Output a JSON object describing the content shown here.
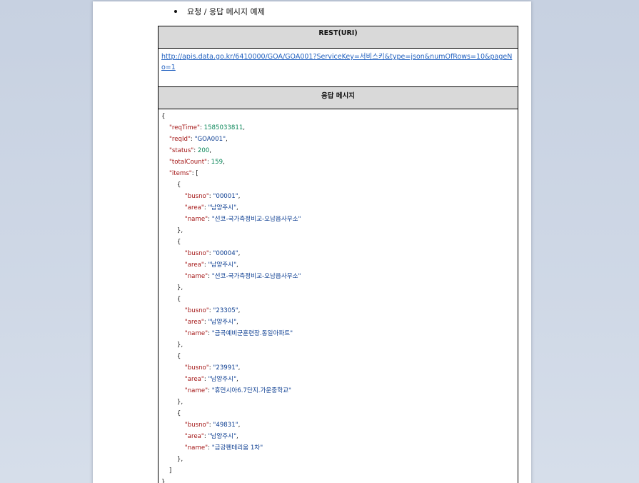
{
  "document": {
    "bullet_text": "요청 / 응답 메시지 예제",
    "table": {
      "request_header": "REST(URI)",
      "request_url": "http://apis.data.go.kr/6410000/GOA/GOA001?ServiceKey=서비스키&type=json&numOfRows=10&pageNo=1",
      "response_header": "응답 메시지"
    },
    "response": {
      "reqTime": "1585033811",
      "reqId": "\"GOA001\"",
      "status": "200",
      "totalCount": "159",
      "items": [
        {
          "busno": "\"00001\"",
          "area": "\"남양주시\"",
          "name": "\"선코-국가측정비교-오남읍사무소\""
        },
        {
          "busno": "\"00004\"",
          "area": "\"남양주시\"",
          "name": "\"선코-국가측정비교-오남읍사무소\""
        },
        {
          "busno": "\"23305\"",
          "area": "\"남양주시\"",
          "name": "\"금곡예비군훈련장.동일아파트\""
        },
        {
          "busno": "\"23991\"",
          "area": "\"남양주시\"",
          "name": "\"휴먼시아6.7단지.가운중학교\""
        },
        {
          "busno": "\"49831\"",
          "area": "\"남양주시\"",
          "name": "\"금강펜테리움 1차\""
        }
      ]
    },
    "keys": {
      "reqTime": "\"reqTime\"",
      "reqId": "\"reqId\"",
      "status": "\"status\"",
      "totalCount": "\"totalCount\"",
      "items": "\"items\"",
      "busno": "\"busno\"",
      "area": "\"area\"",
      "name": "\"name\""
    }
  }
}
